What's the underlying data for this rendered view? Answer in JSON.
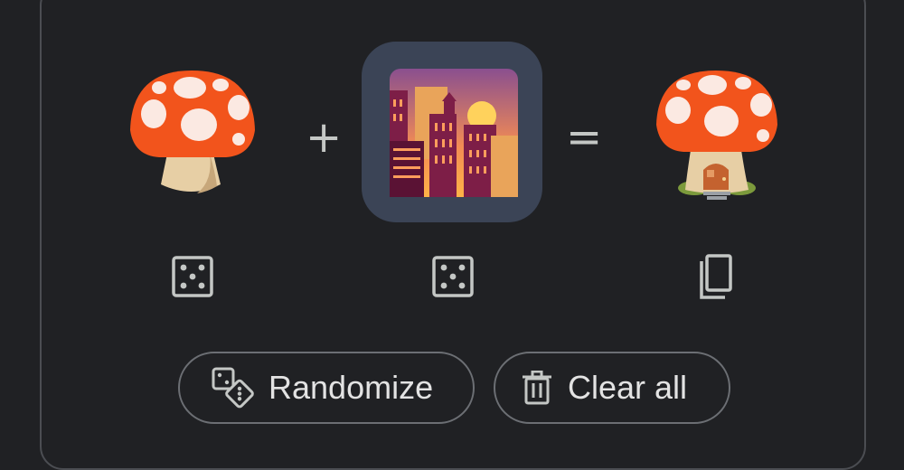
{
  "mixer": {
    "left_emoji_name": "mushroom",
    "right_emoji_name": "night with city / sunset",
    "result_emoji_name": "mushroom house"
  },
  "operators": {
    "plus": "+",
    "equals": "="
  },
  "actions": {
    "left_icon": "dice-icon",
    "middle_icon": "dice-icon",
    "right_icon": "copy-icon"
  },
  "buttons": {
    "randomize_label": "Randomize",
    "clear_label": "Clear all"
  },
  "colors": {
    "background": "#202124",
    "card_border": "#4b4d52",
    "selected_tile": "#3b4456",
    "icon": "#c4c7c5",
    "text": "#e3e3e3"
  }
}
